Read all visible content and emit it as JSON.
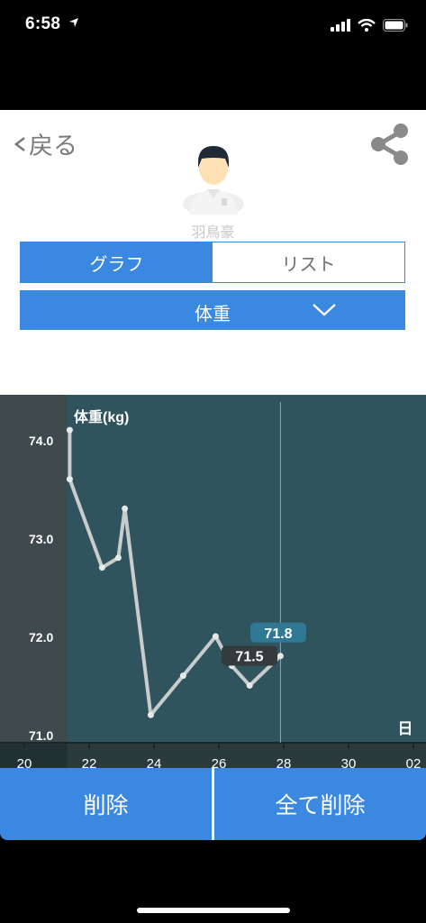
{
  "status": {
    "time": "6:58"
  },
  "header": {
    "back_label": "戻る",
    "user_name": "羽鳥豪"
  },
  "tabs": [
    {
      "label": "グラフ",
      "active": true
    },
    {
      "label": "リスト",
      "active": false
    }
  ],
  "metric_select": {
    "selected": "体重"
  },
  "chart_data": {
    "type": "line",
    "ylabel": "体重(kg)",
    "xlabel": "日",
    "x_ticks": [
      "20",
      "22",
      "24",
      "26",
      "28",
      "30",
      "02"
    ],
    "y_ticks": [
      "74.0",
      "73.0",
      "72.0",
      "71.0"
    ],
    "ylim": [
      71.0,
      74.0
    ],
    "xlim": [
      20,
      33
    ],
    "series": [
      {
        "x": [
          21.4,
          21.4,
          22.4,
          22.9,
          23.1,
          23.9,
          24.9,
          25.9,
          26.4,
          26.95,
          27.9
        ],
        "values": [
          74.1,
          73.6,
          72.7,
          72.8,
          73.3,
          71.2,
          71.6,
          72.0,
          71.7,
          71.5,
          71.8
        ]
      }
    ],
    "selection": {
      "x": 27.9
    },
    "annotations": [
      {
        "label": "71.8",
        "value": 71.8
      },
      {
        "label": "71.5",
        "value": 71.5
      }
    ],
    "colors": {
      "background": "#2f545e",
      "shaded": "#3e4a4c",
      "axis_band": "#2b3a3d",
      "line": "#c8cccd",
      "highlight_label": "#2f7896",
      "dark_label": "#333b3d"
    }
  },
  "actions": {
    "delete_label": "削除",
    "delete_all_label": "全て削除"
  },
  "colors": {
    "accent": "#3a88e0"
  }
}
